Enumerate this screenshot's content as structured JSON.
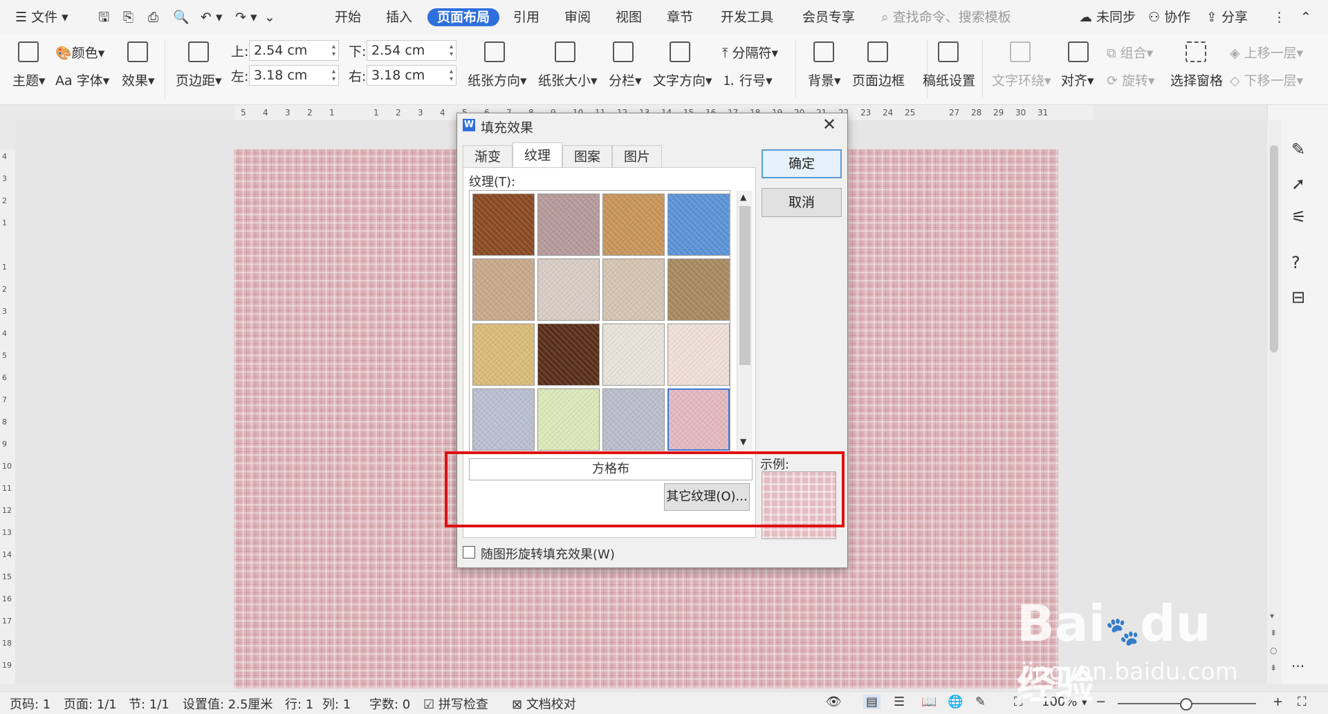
{
  "menubar": {
    "file": "文件",
    "tabs": [
      "开始",
      "插入",
      "页面布局",
      "引用",
      "审阅",
      "视图",
      "章节",
      "开发工具",
      "会员专享"
    ],
    "active_tab": "页面布局",
    "search_placeholder": "查找命令、搜索模板",
    "sync": "未同步",
    "collab": "协作",
    "share": "分享"
  },
  "ribbon": {
    "theme": "主题",
    "colors": "颜色",
    "fonts": "字体",
    "effects": "效果",
    "margins": "页边距",
    "margin_top_label": "上:",
    "margin_top": "2.54 cm",
    "margin_bottom_label": "下:",
    "margin_bottom": "2.54 cm",
    "margin_left_label": "左:",
    "margin_left": "3.18 cm",
    "margin_right_label": "右:",
    "margin_right": "3.18 cm",
    "orientation": "纸张方向",
    "size": "纸张大小",
    "columns": "分栏",
    "text_direction": "文字方向",
    "breaks": "分隔符",
    "line_numbers": "行号",
    "background": "背景",
    "page_border": "页面边框",
    "manuscript": "稿纸设置",
    "text_wrap": "文字环绕",
    "align": "对齐",
    "group": "组合",
    "rotate": "旋转",
    "selection_pane": "选择窗格",
    "bring_forward": "上移一层",
    "send_backward": "下移一层"
  },
  "ruler": {
    "h_ticks": [
      "5",
      "4",
      "3",
      "2",
      "1",
      "",
      "1",
      "2",
      "3",
      "4",
      "5",
      "6",
      "7",
      "8",
      "9",
      "10",
      "11",
      "12",
      "13",
      "14",
      "15",
      "16",
      "17",
      "18",
      "19",
      "20",
      "21",
      "22",
      "23",
      "24",
      "25",
      "",
      "27",
      "28",
      "29",
      "30",
      "31"
    ],
    "v_ticks": [
      "4",
      "3",
      "2",
      "1",
      "",
      "1",
      "2",
      "3",
      "4",
      "5",
      "6",
      "7",
      "8",
      "9",
      "10",
      "11",
      "12",
      "13",
      "14",
      "15",
      "16",
      "17",
      "18",
      "19"
    ]
  },
  "dialog": {
    "title": "填充效果",
    "tabs": [
      "渐变",
      "纹理",
      "图案",
      "图片"
    ],
    "selected_tab": "纹理",
    "texture_label": "纹理(T):",
    "textures": [
      {
        "name": "leather",
        "color": "#8a4a22"
      },
      {
        "name": "fabric-weave",
        "color": "#b59a9a"
      },
      {
        "name": "burlap",
        "color": "#c7955a"
      },
      {
        "name": "blue-tissue",
        "color": "#5b93d6"
      },
      {
        "name": "granite",
        "color": "#c8a88a"
      },
      {
        "name": "white-marble",
        "color": "#d8ccc4"
      },
      {
        "name": "parchment",
        "color": "#d5c4b2"
      },
      {
        "name": "sand",
        "color": "#a88a60"
      },
      {
        "name": "gold-sand",
        "color": "#d9bb78"
      },
      {
        "name": "leopard",
        "color": "#5a2f1a"
      },
      {
        "name": "office-sand",
        "color": "#e8e2da"
      },
      {
        "name": "pink-wood",
        "color": "#efdfd8"
      },
      {
        "name": "denim-stripes",
        "color": "#b9bfd0"
      },
      {
        "name": "green-grid",
        "color": "#dbe8b9"
      },
      {
        "name": "blue-weave",
        "color": "#b9bdcc"
      },
      {
        "name": "pink-plaid",
        "color": "#e3b9bf"
      }
    ],
    "selected_texture_name": "方格布",
    "other_texture": "其它纹理(O)...",
    "sample_label": "示例:",
    "rotate_checkbox": "随图形旋转填充效果(W)",
    "rotate_checked": false,
    "ok": "确定",
    "cancel": "取消"
  },
  "status": {
    "page_num": "页码: 1",
    "pages": "页面: 1/1",
    "section": "节: 1/1",
    "setting": "设置值: 2.5厘米",
    "line": "行: 1",
    "col": "列: 1",
    "words": "字数: 0",
    "spell": "拼写检查",
    "proof": "文档校对",
    "zoom": "100%"
  },
  "watermark": {
    "brand": "Bai",
    "brand2": "du",
    "cn": "经验",
    "url": "jingyan.baidu.com"
  }
}
